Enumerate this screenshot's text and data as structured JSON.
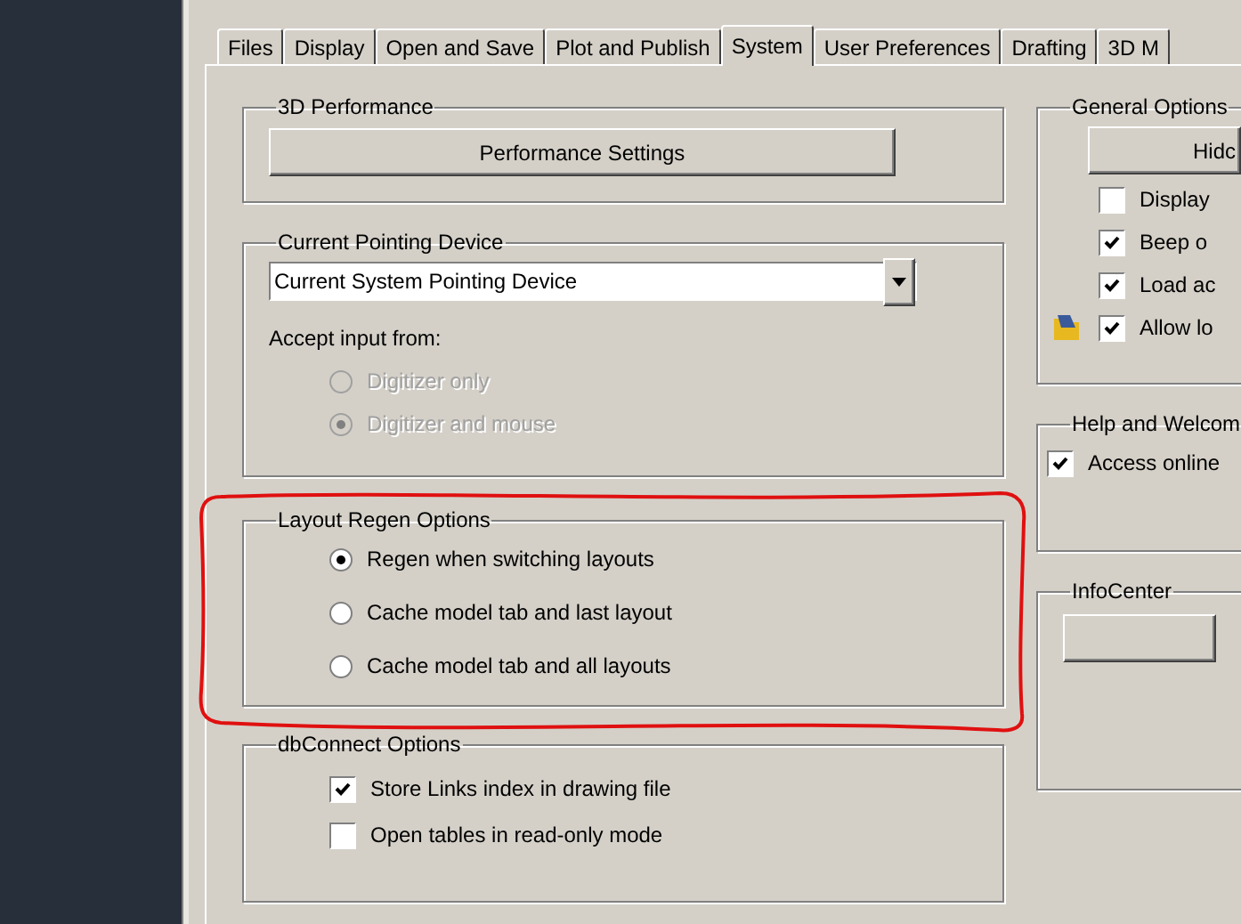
{
  "tabs": [
    {
      "label": "Files",
      "selected": false
    },
    {
      "label": "Display",
      "selected": false
    },
    {
      "label": "Open and Save",
      "selected": false
    },
    {
      "label": "Plot and Publish",
      "selected": false
    },
    {
      "label": "System",
      "selected": true
    },
    {
      "label": "User Preferences",
      "selected": false
    },
    {
      "label": "Drafting",
      "selected": false
    },
    {
      "label": "3D M",
      "selected": false
    }
  ],
  "performance": {
    "title": "3D Performance",
    "button": "Performance Settings"
  },
  "pointing_device": {
    "title": "Current Pointing Device",
    "dropdown_value": "Current System Pointing Device",
    "accept_label": "Accept input from:",
    "options": [
      {
        "label": "Digitizer only",
        "selected": false,
        "disabled": true
      },
      {
        "label": "Digitizer and mouse",
        "selected": true,
        "disabled": true
      }
    ]
  },
  "layout_regen": {
    "title": "Layout Regen Options",
    "highlighted": true,
    "options": [
      {
        "label": "Regen when switching layouts",
        "selected": true,
        "disabled": false
      },
      {
        "label": "Cache model tab and last layout",
        "selected": false,
        "disabled": false
      },
      {
        "label": "Cache model tab and all layouts",
        "selected": false,
        "disabled": false
      }
    ]
  },
  "dbconnect": {
    "title": "dbConnect Options",
    "options": [
      {
        "label": "Store Links index in drawing file",
        "checked": true
      },
      {
        "label": "Open tables in read-only mode",
        "checked": false
      }
    ]
  },
  "general": {
    "title": "General Options",
    "button": "Hidc",
    "options": [
      {
        "label": "Display",
        "checked": false
      },
      {
        "label": "Beep o",
        "checked": true
      },
      {
        "label": "Load ac",
        "checked": true
      },
      {
        "label": "Allow lo",
        "checked": true,
        "icon": true
      }
    ]
  },
  "help": {
    "title": "Help and Welcom",
    "options": [
      {
        "label": "Access online",
        "checked": true
      }
    ]
  },
  "infocenter": {
    "title": "InfoCenter"
  }
}
